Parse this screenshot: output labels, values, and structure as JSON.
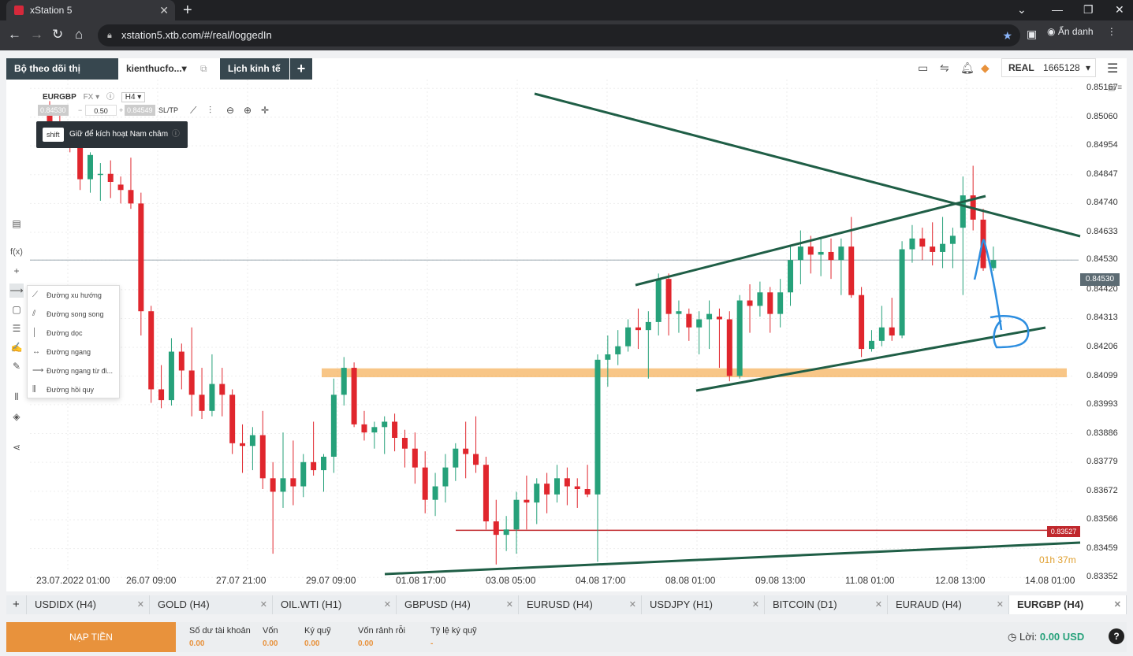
{
  "browser": {
    "tab_title": "xStation 5",
    "tab_close": "✕",
    "new_tab": "+",
    "url": "xstation5.xtb.com/#/real/loggedIn",
    "profile_label": "Ẩn danh"
  },
  "app": {
    "tabs": [
      "Bộ theo dõi thị trường",
      "kienthucfo...",
      "Lịch kinh tế",
      "+"
    ],
    "account_type": "REAL",
    "account_number": "1665128"
  },
  "chart_header": {
    "symbol": "EURGBP",
    "symbol_type": "FX",
    "timeframe": "H4",
    "sell_price": "0.84530",
    "volume": "0.50",
    "buy_price": "0.84549",
    "sltp_label": "SL/TP",
    "hint_key": "shift",
    "hint_text": "Giữ để kích hoạt Nam châm"
  },
  "draw_menu": [
    "Đường xu hướng",
    "Đường song song",
    "Đường dọc",
    "Đường ngang",
    "Đường ngang từ đi...",
    "Đường hồi quy"
  ],
  "chart_data": {
    "type": "candlestick",
    "symbol": "EURGBP",
    "timeframe": "H4",
    "y_ticks": [
      "0.85167",
      "0.85060",
      "0.84954",
      "0.84847",
      "0.84740",
      "0.84633",
      "0.84530",
      "0.84420",
      "0.84313",
      "0.84206",
      "0.84099",
      "0.83993",
      "0.83886",
      "0.83779",
      "0.83672",
      "0.83566",
      "0.83459",
      "0.83352"
    ],
    "x_ticks": [
      "23.07.2022 01:00",
      "26.07 09:00",
      "27.07 21:00",
      "29.07 09:00",
      "01.08 17:00",
      "03.08 05:00",
      "04.08 17:00",
      "08.08 01:00",
      "09.08 13:00",
      "11.08 01:00",
      "12.08 13:00",
      "14.08 01:00"
    ],
    "current_price": "0.84530",
    "pending_level": "0.83527",
    "timer": "01h 37m",
    "ylim": [
      0.833,
      0.852
    ],
    "candles": [
      [
        0.8507,
        0.8512,
        0.8501,
        0.8504
      ],
      [
        0.8504,
        0.8508,
        0.8497,
        0.8499
      ],
      [
        0.8499,
        0.8503,
        0.8493,
        0.8495
      ],
      [
        0.8495,
        0.8498,
        0.8479,
        0.8483
      ],
      [
        0.8483,
        0.8493,
        0.8478,
        0.8492
      ],
      [
        0.8485,
        0.8489,
        0.8475,
        0.8485
      ],
      [
        0.8485,
        0.849,
        0.8476,
        0.8482
      ],
      [
        0.8481,
        0.8484,
        0.8474,
        0.8479
      ],
      [
        0.8479,
        0.8491,
        0.8472,
        0.8474
      ],
      [
        0.8474,
        0.8478,
        0.8425,
        0.8434
      ],
      [
        0.8434,
        0.8436,
        0.84,
        0.8405
      ],
      [
        0.8405,
        0.8414,
        0.8398,
        0.8401
      ],
      [
        0.8401,
        0.8424,
        0.8399,
        0.8419
      ],
      [
        0.8419,
        0.8422,
        0.8405,
        0.8412
      ],
      [
        0.8412,
        0.8428,
        0.8395,
        0.8403
      ],
      [
        0.8403,
        0.8413,
        0.8394,
        0.8397
      ],
      [
        0.8397,
        0.8418,
        0.8395,
        0.8407
      ],
      [
        0.8407,
        0.8413,
        0.8395,
        0.8403
      ],
      [
        0.8403,
        0.8405,
        0.8381,
        0.8385
      ],
      [
        0.8385,
        0.8392,
        0.8374,
        0.8384
      ],
      [
        0.8384,
        0.8391,
        0.8375,
        0.8388
      ],
      [
        0.8388,
        0.8397,
        0.8368,
        0.8372
      ],
      [
        0.8372,
        0.8378,
        0.8344,
        0.8367
      ],
      [
        0.8367,
        0.8389,
        0.8361,
        0.8372
      ],
      [
        0.8372,
        0.8386,
        0.8362,
        0.8369
      ],
      [
        0.8369,
        0.8381,
        0.8365,
        0.8378
      ],
      [
        0.8378,
        0.8393,
        0.8373,
        0.8375
      ],
      [
        0.8375,
        0.8381,
        0.8367,
        0.838
      ],
      [
        0.838,
        0.8409,
        0.8374,
        0.8403
      ],
      [
        0.8403,
        0.8417,
        0.8399,
        0.8413
      ],
      [
        0.8413,
        0.8415,
        0.8391,
        0.8392
      ],
      [
        0.8392,
        0.8397,
        0.8386,
        0.8389
      ],
      [
        0.8389,
        0.8393,
        0.8383,
        0.8391
      ],
      [
        0.8391,
        0.8395,
        0.8381,
        0.8393
      ],
      [
        0.8393,
        0.8396,
        0.8382,
        0.8387
      ],
      [
        0.8387,
        0.839,
        0.8376,
        0.8383
      ],
      [
        0.8383,
        0.8389,
        0.837,
        0.8376
      ],
      [
        0.8376,
        0.8382,
        0.8359,
        0.8364
      ],
      [
        0.8364,
        0.8374,
        0.8358,
        0.8369
      ],
      [
        0.8369,
        0.8381,
        0.8363,
        0.8376
      ],
      [
        0.8376,
        0.8385,
        0.8371,
        0.8383
      ],
      [
        0.8383,
        0.8393,
        0.8372,
        0.8381
      ],
      [
        0.8381,
        0.8395,
        0.8374,
        0.8377
      ],
      [
        0.8377,
        0.838,
        0.8353,
        0.8356
      ],
      [
        0.8356,
        0.8364,
        0.834,
        0.8351
      ],
      [
        0.8351,
        0.8358,
        0.8345,
        0.8353
      ],
      [
        0.8353,
        0.8367,
        0.8344,
        0.8364
      ],
      [
        0.8364,
        0.8373,
        0.8353,
        0.8363
      ],
      [
        0.8363,
        0.8372,
        0.8355,
        0.837
      ],
      [
        0.837,
        0.8374,
        0.8359,
        0.8366
      ],
      [
        0.8366,
        0.8377,
        0.8363,
        0.8372
      ],
      [
        0.8372,
        0.8376,
        0.8362,
        0.8369
      ],
      [
        0.8369,
        0.8372,
        0.8361,
        0.8368
      ],
      [
        0.8368,
        0.8377,
        0.8365,
        0.8366
      ],
      [
        0.8366,
        0.8418,
        0.8341,
        0.8416
      ],
      [
        0.8416,
        0.8425,
        0.8406,
        0.8418
      ],
      [
        0.8418,
        0.8427,
        0.8414,
        0.8421
      ],
      [
        0.8421,
        0.8431,
        0.8419,
        0.8428
      ],
      [
        0.8428,
        0.8435,
        0.842,
        0.8427
      ],
      [
        0.8427,
        0.8434,
        0.8409,
        0.843
      ],
      [
        0.843,
        0.8448,
        0.8425,
        0.8446
      ],
      [
        0.8446,
        0.8448,
        0.8425,
        0.8433
      ],
      [
        0.8433,
        0.8438,
        0.8426,
        0.8434
      ],
      [
        0.8433,
        0.8435,
        0.8423,
        0.8428
      ],
      [
        0.8428,
        0.8434,
        0.8418,
        0.8431
      ],
      [
        0.8431,
        0.8438,
        0.842,
        0.8433
      ],
      [
        0.8432,
        0.8435,
        0.8413,
        0.8431
      ],
      [
        0.8431,
        0.8434,
        0.8408,
        0.841
      ],
      [
        0.841,
        0.844,
        0.8409,
        0.8438
      ],
      [
        0.8438,
        0.8444,
        0.8426,
        0.8436
      ],
      [
        0.8436,
        0.8445,
        0.8432,
        0.8441
      ],
      [
        0.8441,
        0.8443,
        0.8426,
        0.8433
      ],
      [
        0.8433,
        0.8446,
        0.8428,
        0.8441
      ],
      [
        0.8441,
        0.8458,
        0.8436,
        0.8453
      ],
      [
        0.8453,
        0.8464,
        0.8444,
        0.8458
      ],
      [
        0.8458,
        0.8462,
        0.8448,
        0.8455
      ],
      [
        0.8455,
        0.8461,
        0.8447,
        0.8456
      ],
      [
        0.8456,
        0.8461,
        0.8446,
        0.8453
      ],
      [
        0.8453,
        0.8461,
        0.844,
        0.8458
      ],
      [
        0.8458,
        0.8469,
        0.8439,
        0.844
      ],
      [
        0.844,
        0.8443,
        0.8417,
        0.842
      ],
      [
        0.842,
        0.8427,
        0.8419,
        0.8423
      ],
      [
        0.8423,
        0.8436,
        0.8421,
        0.8428
      ],
      [
        0.8428,
        0.8439,
        0.8423,
        0.8425
      ],
      [
        0.8425,
        0.846,
        0.8424,
        0.8457
      ],
      [
        0.8457,
        0.8466,
        0.8452,
        0.8461
      ],
      [
        0.8461,
        0.8465,
        0.8453,
        0.8458
      ],
      [
        0.8458,
        0.8467,
        0.8451,
        0.8456
      ],
      [
        0.8456,
        0.8469,
        0.845,
        0.8459
      ],
      [
        0.8459,
        0.8465,
        0.845,
        0.8462
      ],
      [
        0.8465,
        0.8484,
        0.844,
        0.8477
      ],
      [
        0.8477,
        0.8488,
        0.8464,
        0.8468
      ],
      [
        0.8468,
        0.8472,
        0.8449,
        0.845
      ],
      [
        0.845,
        0.8458,
        0.8449,
        0.8453
      ]
    ]
  },
  "instrument_tabs": [
    "USDIDX (H4)",
    "GOLD (H4)",
    "OIL.WTI (H1)",
    "GBPUSD (H4)",
    "EURUSD (H4)",
    "USDJPY (H1)",
    "BITCOIN (D1)",
    "EURAUD (H4)",
    "EURGBP (H4)"
  ],
  "instrument_add": "+",
  "footer": {
    "deposit_label": "NẠP TIỀN",
    "columns": [
      {
        "label": "Số dư tài khoản",
        "value": "0.00"
      },
      {
        "label": "Vốn",
        "value": "0.00"
      },
      {
        "label": "Ký quỹ",
        "value": "0.00"
      },
      {
        "label": "Vốn rảnh rỗi",
        "value": "0.00"
      },
      {
        "label": "Tỷ lệ ký quỹ",
        "value": "-"
      }
    ],
    "profit_label": "Lời:",
    "profit_value": "0.00 USD",
    "help": "?"
  },
  "colors": {
    "bull": "#26a17a",
    "bear": "#e0262d",
    "trendline": "#1f5e46",
    "zone": "#f5a847",
    "pending": "#c0282d",
    "annotation": "#2d8ee0"
  }
}
